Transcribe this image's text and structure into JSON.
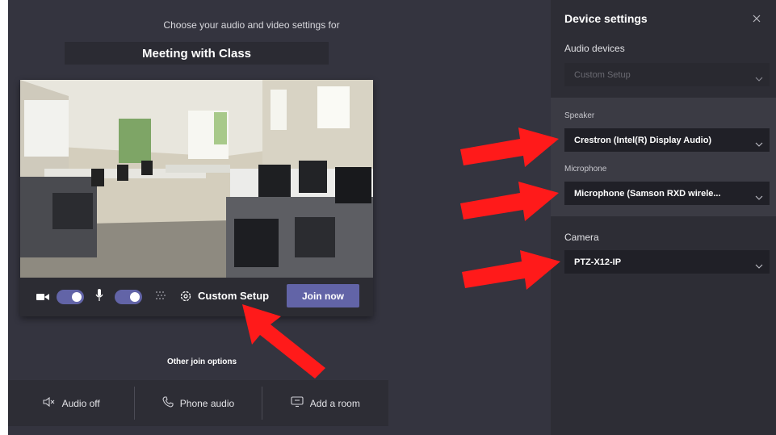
{
  "prejoin": {
    "choose_text": "Choose your audio and video settings for",
    "meeting_title": "Meeting with Class",
    "controls": {
      "custom_setup_label": "Custom Setup",
      "join_label": "Join now",
      "camera_on": true,
      "mic_on": true
    },
    "other_join_options_label": "Other join options",
    "join_options": [
      {
        "label": "Audio off",
        "icon": "speaker-off-icon"
      },
      {
        "label": "Phone audio",
        "icon": "phone-icon"
      },
      {
        "label": "Add a room",
        "icon": "cast-icon"
      }
    ]
  },
  "device_settings": {
    "title": "Device settings",
    "audio_devices_label": "Audio devices",
    "audio_devices_value": "Custom Setup",
    "speaker_label": "Speaker",
    "speaker_value": "Crestron (Intel(R) Display Audio)",
    "microphone_label": "Microphone",
    "microphone_value": "Microphone (Samson RXD wirele...",
    "camera_label": "Camera",
    "camera_value": "PTZ-X12-IP"
  },
  "colors": {
    "accent": "#6264a7",
    "annotation_arrow": "#ff1a1a"
  }
}
